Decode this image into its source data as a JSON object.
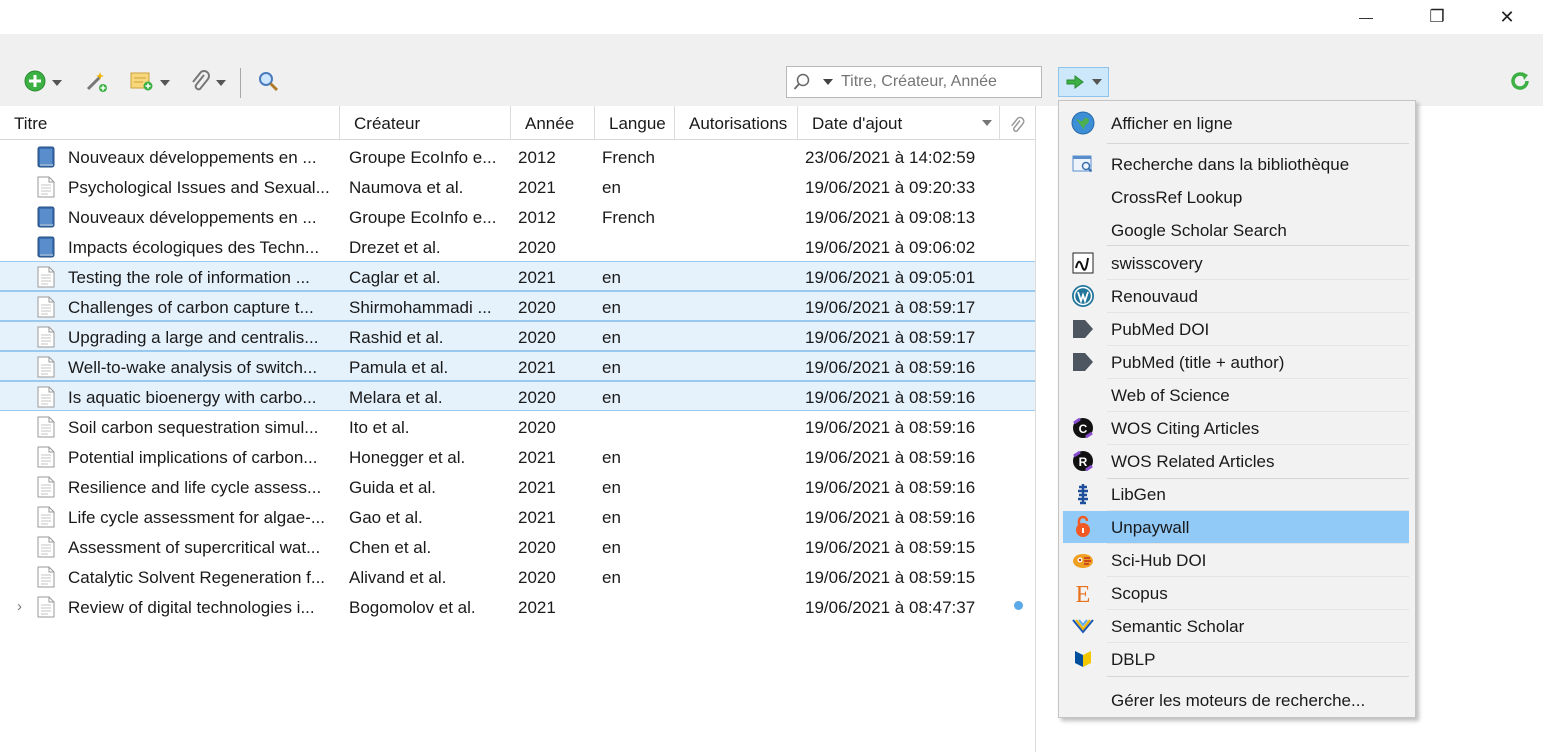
{
  "window": {
    "minimize_glyph": "—",
    "maximize_glyph": "❐",
    "close_glyph": "✕"
  },
  "toolbar": {
    "search_placeholder": "Titre, Créateur, Année",
    "icons": [
      "new-item-icon",
      "magic-wand-icon",
      "new-note-icon",
      "attachment-icon",
      "advanced-search-icon",
      "locate-icon",
      "sync-icon"
    ]
  },
  "columns": {
    "title": "Titre",
    "creator": "Créateur",
    "year": "Année",
    "language": "Langue",
    "rights": "Autorisations",
    "date_added": "Date d'ajout"
  },
  "rows": [
    {
      "icon": "book",
      "title": "Nouveaux développements en ...",
      "creator": "Groupe EcoInfo e...",
      "year": "2012",
      "lang": "French",
      "date": "23/06/2021 à 14:02:59"
    },
    {
      "icon": "doc",
      "title": "Psychological Issues and Sexual...",
      "creator": "Naumova et al.",
      "year": "2021",
      "lang": "en",
      "date": "19/06/2021 à 09:20:33"
    },
    {
      "icon": "book",
      "title": "Nouveaux développements en ...",
      "creator": "Groupe EcoInfo e...",
      "year": "2012",
      "lang": "French",
      "date": "19/06/2021 à 09:08:13"
    },
    {
      "icon": "book",
      "title": "Impacts écologiques des Techn...",
      "creator": "Drezet et al.",
      "year": "2020",
      "lang": "",
      "date": "19/06/2021 à 09:06:02"
    },
    {
      "icon": "doc",
      "title": "Testing the role of information ...",
      "creator": "Caglar et al.",
      "year": "2021",
      "lang": "en",
      "date": "19/06/2021 à 09:05:01",
      "selected": true
    },
    {
      "icon": "doc",
      "title": "Challenges of carbon capture t...",
      "creator": "Shirmohammadi ...",
      "year": "2020",
      "lang": "en",
      "date": "19/06/2021 à 08:59:17",
      "selected": true
    },
    {
      "icon": "doc",
      "title": "Upgrading a large and centralis...",
      "creator": "Rashid et al.",
      "year": "2020",
      "lang": "en",
      "date": "19/06/2021 à 08:59:17",
      "selected": true
    },
    {
      "icon": "doc",
      "title": "Well-to-wake analysis of switch...",
      "creator": "Pamula et al.",
      "year": "2021",
      "lang": "en",
      "date": "19/06/2021 à 08:59:16",
      "selected": true
    },
    {
      "icon": "doc",
      "title": "Is aquatic bioenergy with carbo...",
      "creator": "Melara et al.",
      "year": "2020",
      "lang": "en",
      "date": "19/06/2021 à 08:59:16",
      "selected": true
    },
    {
      "icon": "doc",
      "title": "Soil carbon sequestration simul...",
      "creator": "Ito et al.",
      "year": "2020",
      "lang": "",
      "date": "19/06/2021 à 08:59:16"
    },
    {
      "icon": "doc",
      "title": "Potential implications of carbon...",
      "creator": "Honegger et al.",
      "year": "2021",
      "lang": "en",
      "date": "19/06/2021 à 08:59:16"
    },
    {
      "icon": "doc",
      "title": "Resilience and life cycle assess...",
      "creator": "Guida et al.",
      "year": "2021",
      "lang": "en",
      "date": "19/06/2021 à 08:59:16"
    },
    {
      "icon": "doc",
      "title": "Life cycle assessment for algae-...",
      "creator": "Gao et al.",
      "year": "2021",
      "lang": "en",
      "date": "19/06/2021 à 08:59:16"
    },
    {
      "icon": "doc",
      "title": "Assessment of supercritical wat...",
      "creator": "Chen et al.",
      "year": "2020",
      "lang": "en",
      "date": "19/06/2021 à 08:59:15"
    },
    {
      "icon": "doc",
      "title": "Catalytic Solvent Regeneration f...",
      "creator": "Alivand et al.",
      "year": "2020",
      "lang": "en",
      "date": "19/06/2021 à 08:59:15"
    },
    {
      "icon": "doc",
      "title": "Review of digital technologies i...",
      "creator": "Bogomolov et al.",
      "year": "2021",
      "lang": "",
      "date": "19/06/2021 à 08:47:37",
      "expandable": true,
      "unread_dot": true
    }
  ],
  "menu": {
    "items": [
      {
        "label": "Afficher en ligne",
        "icon": "globe-icon"
      },
      {
        "label": "Recherche dans la bibliothèque",
        "icon": "library-search-icon"
      },
      {
        "label": "CrossRef Lookup",
        "icon": ""
      },
      {
        "label": "Google Scholar Search",
        "icon": ""
      },
      {
        "label": "swisscovery",
        "icon": "swisscovery-icon"
      },
      {
        "label": "Renouvaud",
        "icon": "wordpress-icon"
      },
      {
        "label": "PubMed DOI",
        "icon": "pubmed-icon"
      },
      {
        "label": "PubMed (title + author)",
        "icon": "pubmed-icon"
      },
      {
        "label": "Web of Science",
        "icon": ""
      },
      {
        "label": "WOS Citing Articles",
        "icon": "wos-citing-icon"
      },
      {
        "label": "WOS Related Articles",
        "icon": "wos-related-icon"
      },
      {
        "label": "LibGen",
        "icon": "libgen-icon"
      },
      {
        "label": "Unpaywall",
        "icon": "unpaywall-icon",
        "highlighted": true
      },
      {
        "label": "Sci-Hub DOI",
        "icon": "scihub-icon"
      },
      {
        "label": "Scopus",
        "icon": "scopus-icon"
      },
      {
        "label": "Semantic Scholar",
        "icon": "semantic-scholar-icon"
      },
      {
        "label": "DBLP",
        "icon": "dblp-icon"
      },
      {
        "label": "Gérer les moteurs de recherche...",
        "icon": ""
      }
    ],
    "scopus_letter": "E"
  },
  "colors": {
    "selection": "#e5f1fb",
    "menu_highlight": "#91c9f7",
    "green": "#3cb043",
    "book_blue": "#3a6fb0"
  }
}
